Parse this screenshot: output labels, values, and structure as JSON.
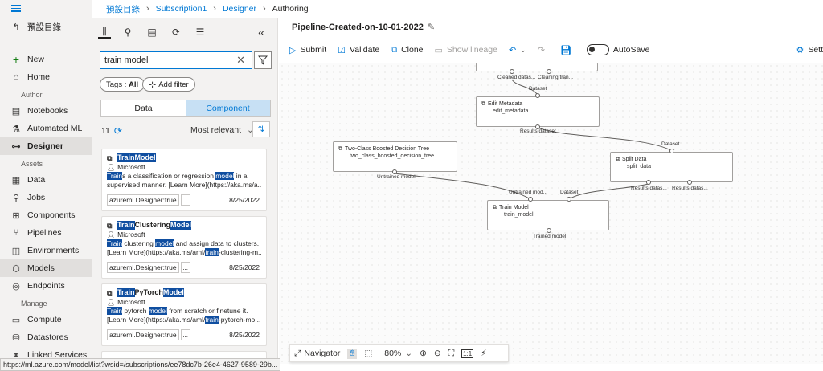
{
  "nav": {
    "back_label": "預設目錄",
    "items": [
      {
        "label": "New",
        "icon": "plus-icon"
      },
      {
        "label": "Home",
        "icon": "home-icon"
      },
      {
        "label": "Notebooks",
        "icon": "notebook-icon"
      },
      {
        "label": "Automated ML",
        "icon": "automl-icon"
      },
      {
        "label": "Designer",
        "icon": "designer-icon"
      },
      {
        "label": "Data",
        "icon": "data-icon"
      },
      {
        "label": "Jobs",
        "icon": "jobs-icon"
      },
      {
        "label": "Components",
        "icon": "components-icon"
      },
      {
        "label": "Pipelines",
        "icon": "pipelines-icon"
      },
      {
        "label": "Environments",
        "icon": "environments-icon"
      },
      {
        "label": "Models",
        "icon": "models-icon"
      },
      {
        "label": "Endpoints",
        "icon": "endpoints-icon"
      },
      {
        "label": "Compute",
        "icon": "compute-icon"
      },
      {
        "label": "Datastores",
        "icon": "datastores-icon"
      },
      {
        "label": "Linked Services",
        "icon": "linked-services-icon"
      }
    ],
    "sections": {
      "author": "Author",
      "assets": "Assets",
      "manage": "Manage"
    }
  },
  "breadcrumb": {
    "items": [
      "預設目錄",
      "Subscription1",
      "Designer",
      "Authoring"
    ]
  },
  "panel": {
    "search_value": "train model",
    "tags_label": "Tags :",
    "tags_value": "All",
    "add_filter": "Add filter",
    "tabs": {
      "data": "Data",
      "component": "Component"
    },
    "count": "11",
    "sort_label": "Most relevant",
    "cards": [
      {
        "title_parts": [
          {
            "t": "Train",
            "h": true
          },
          {
            "t": " ",
            "h": false
          },
          {
            "t": "Model",
            "h": true
          }
        ],
        "author": "Microsoft",
        "desc1_parts": [
          {
            "t": "Train",
            "h": true
          },
          {
            "t": "s a classification or regression ",
            "h": false
          },
          {
            "t": "model",
            "h": true
          },
          {
            "t": " in a",
            "h": false
          }
        ],
        "desc2_parts": [
          {
            "t": "supervised manner. [Learn More](https://aka.ms/a...",
            "h": false
          }
        ],
        "tag": "azureml.Designer:true",
        "more": "...",
        "date": "8/25/2022"
      },
      {
        "title_parts": [
          {
            "t": "Train",
            "h": true
          },
          {
            "t": " Clustering ",
            "h": false
          },
          {
            "t": "Model",
            "h": true
          }
        ],
        "author": "Microsoft",
        "desc1_parts": [
          {
            "t": "Train",
            "h": true
          },
          {
            "t": " clustering ",
            "h": false
          },
          {
            "t": "model",
            "h": true
          },
          {
            "t": " and assign data to clusters.",
            "h": false
          }
        ],
        "desc2_parts": [
          {
            "t": "[Learn More](https://aka.ms/aml/",
            "h": false
          },
          {
            "t": "train",
            "h": true
          },
          {
            "t": "-clustering-m...",
            "h": false
          }
        ],
        "tag": "azureml.Designer:true",
        "more": "...",
        "date": "8/25/2022"
      },
      {
        "title_parts": [
          {
            "t": "Train",
            "h": true
          },
          {
            "t": " PyTorch ",
            "h": false
          },
          {
            "t": "Model",
            "h": true
          }
        ],
        "author": "Microsoft",
        "desc1_parts": [
          {
            "t": "Train",
            "h": true
          },
          {
            "t": " pytorch ",
            "h": false
          },
          {
            "t": "model",
            "h": true
          },
          {
            "t": " from scratch or finetune it.",
            "h": false
          }
        ],
        "desc2_parts": [
          {
            "t": "[Learn More](https://aka.ms/aml/",
            "h": false
          },
          {
            "t": "train",
            "h": true
          },
          {
            "t": "-pytorch-mo...",
            "h": false
          }
        ],
        "tag": "azureml.Designer:true",
        "more": "...",
        "date": "8/25/2022"
      }
    ]
  },
  "canvas": {
    "pipeline_title": "Pipeline-Created-on-10-01-2022",
    "toolbar": {
      "submit": "Submit",
      "validate": "Validate",
      "clone": "Clone",
      "show_lineage": "Show lineage",
      "autosave": "AutoSave",
      "settings": "Sett"
    },
    "nodes": {
      "top_ports": {
        "left": "Cleaned datas...",
        "right": "Cleaning tran..."
      },
      "edit_metadata": {
        "title": "Edit Metadata",
        "subtitle": "edit_metadata",
        "in_port": "Dataset",
        "out_port": "Results dataset"
      },
      "boosted_tree": {
        "title": "Two-Class Boosted Decision Tree",
        "subtitle": "two_class_boosted_decision_tree",
        "out_port": "Untrained model"
      },
      "split_data": {
        "title": "Split Data",
        "subtitle": "split_data",
        "in_port": "Dataset",
        "out_left": "Results datas...",
        "out_right": "Results datas..."
      },
      "train_model": {
        "title": "Train Model",
        "subtitle": "train_model",
        "in_left": "Untrained mod...",
        "in_right": "Dataset",
        "out_port": "Trained model"
      }
    },
    "navigator": {
      "label": "Navigator",
      "zoom": "80%"
    }
  },
  "status_url": "https://ml.azure.com/model/list?wsid=/subscriptions/ee78dc7b-26e4-4627-9589-29b..."
}
